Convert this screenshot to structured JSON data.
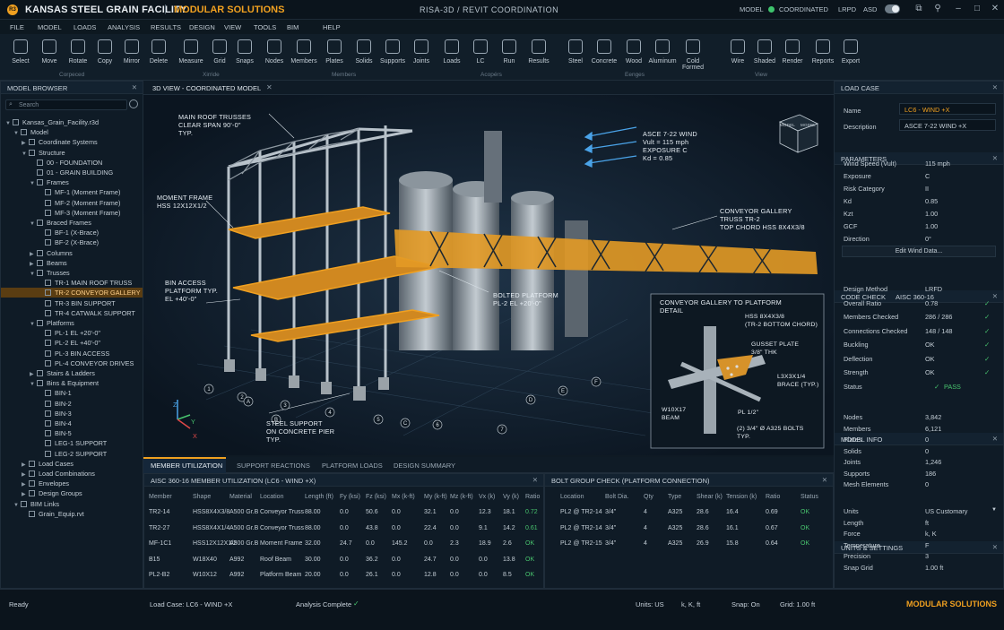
{
  "app": {
    "logo": "R3",
    "name": "KANSAS STEEL GRAIN FACILITY",
    "sep": "|",
    "subtitle": "MODULAR SOLUTIONS",
    "center_title": "RISA-3D / REVIT COORDINATION",
    "model_label": "MODEL",
    "model_status": "COORDINATED",
    "lrfd": "LRPD",
    "asd": "ASD"
  },
  "menu": [
    "FILE",
    "MODEL",
    "LOADS",
    "ANALYSIS",
    "RESULTS",
    "DESIGN",
    "VIEW",
    "TOOLS",
    "BIM",
    "HELP"
  ],
  "ribbon": {
    "tools": [
      {
        "label": "Select",
        "icon": "select-icon"
      },
      {
        "label": "Move",
        "icon": "move-icon"
      },
      {
        "label": "Rotate",
        "icon": "rotate-icon"
      },
      {
        "label": "Copy",
        "icon": "copy-icon"
      },
      {
        "label": "Mirror",
        "icon": "mirror-icon"
      },
      {
        "label": "Delete",
        "icon": "delete-icon"
      },
      {
        "label": "Measure",
        "icon": "measure-icon"
      },
      {
        "label": "Grid",
        "icon": "grid-icon"
      },
      {
        "label": "Snaps",
        "icon": "snaps-icon"
      },
      {
        "label": "Nodes",
        "icon": "nodes-icon"
      },
      {
        "label": "Members",
        "icon": "members-icon"
      },
      {
        "label": "Plates",
        "icon": "plates-icon"
      },
      {
        "label": "Solids",
        "icon": "solids-icon"
      },
      {
        "label": "Supports",
        "icon": "supports-icon"
      },
      {
        "label": "Joints",
        "icon": "joints-icon"
      },
      {
        "label": "Loads",
        "icon": "loads-icon"
      },
      {
        "label": "LC",
        "icon": "lc-icon"
      },
      {
        "label": "Run",
        "icon": "run-icon"
      },
      {
        "label": "Results",
        "icon": "results-icon"
      },
      {
        "label": "Steel",
        "icon": "steel-icon"
      },
      {
        "label": "Concrete",
        "icon": "concrete-icon"
      },
      {
        "label": "Wood",
        "icon": "wood-icon"
      },
      {
        "label": "Aluminum",
        "icon": "aluminum-icon"
      },
      {
        "label": "Cold Formed",
        "icon": "cold-formed-icon"
      },
      {
        "label": "Wire",
        "icon": "wire-icon"
      },
      {
        "label": "Shaded",
        "icon": "shaded-icon"
      },
      {
        "label": "Render",
        "icon": "render-icon"
      },
      {
        "label": "Reports",
        "icon": "reports-icon"
      },
      {
        "label": "Export",
        "icon": "export-icon"
      }
    ],
    "groups": [
      "Corpeced",
      "Xirride",
      "Members",
      "Acopérs",
      "Eenges",
      "View"
    ]
  },
  "browser": {
    "title": "MODEL BROWSER",
    "search_placeholder": "Search",
    "items": [
      "Kansas_Grain_Facility.r3d",
      "Model",
      "Coordinate Systems",
      "Structure",
      "00 - FOUNDATION",
      "01 - GRAIN BUILDING",
      "Frames",
      "MF-1 (Moment Frame)",
      "MF-2 (Moment Frame)",
      "MF-3 (Moment Frame)",
      "Braced Frames",
      "BF-1 (X-Brace)",
      "BF-2 (X-Brace)",
      "Columns",
      "Beams",
      "Trusses",
      "TR-1 MAIN ROOF TRUSS",
      "TR-2 CONVEYOR GALLERY",
      "TR-3 BIN SUPPORT",
      "TR-4 CATWALK SUPPORT",
      "Platforms",
      "PL-1 EL +20'-0\"",
      "PL-2 EL +40'-0\"",
      "PL-3 BIN ACCESS",
      "PL-4 CONVEYOR DRIVES",
      "Stairs & Ladders",
      "Bins & Equipment",
      "BIN-1",
      "BIN-2",
      "BIN-3",
      "BIN-4",
      "BIN-5",
      "LEG-1 SUPPORT",
      "LEG-2 SUPPORT",
      "Load Cases",
      "Load Combinations",
      "Envelopes",
      "Design Groups",
      "BIM Links",
      "Grain_Equip.rvt"
    ]
  },
  "view": {
    "tab": "3D VIEW - COORDINATED MODEL",
    "cube_top": "MODEL",
    "cube_side": "MODEL",
    "ann": {
      "roof": [
        "MAIN ROOF TRUSSES",
        "CLEAR SPAN 90'-0\"",
        "TYP."
      ],
      "wind": [
        "ASCE 7-22 WIND",
        "Vult = 115 mph",
        "EXPOSURE C",
        "Kd = 0.85"
      ],
      "moment": [
        "MOMENT FRAME",
        "HSS 12X12X1/2"
      ],
      "conveyor": [
        "CONVEYOR GALLERY",
        "TRUSS TR-2",
        "TOP CHORD HSS 8X4X3/8"
      ],
      "bin": [
        "BIN ACCESS",
        "PLATFORM TYP.",
        "EL +40'-0\""
      ],
      "bolted": [
        "BOLTED PLATFORM",
        "PL-2 EL +20'-0\""
      ],
      "steel": [
        "STEEL SUPPORT",
        "ON CONCRETE PIER",
        "TYP."
      ]
    },
    "detail": {
      "title": [
        "CONVEYOR GALLERY TO PLATFORM",
        "DETAIL"
      ],
      "hss": [
        "HSS 8X4X3/8",
        "(TR-2 BOTTOM CHORD)"
      ],
      "gusset": [
        "GUSSET PLATE",
        "3/8\" THK"
      ],
      "brace": [
        "L3X3X1/4",
        "BRACE (TYP.)"
      ],
      "beam": [
        "W10X17",
        "BEAM"
      ],
      "pl": "PL 1/2\"",
      "bolts": [
        "(2) 3/4\" Ø A325 BOLTS",
        "TYP."
      ]
    },
    "axes": {
      "x": "X",
      "y": "Y",
      "z": "Z"
    },
    "grid_bubbles": [
      "1",
      "2",
      "3",
      "4",
      "5",
      "6",
      "7",
      "A",
      "B",
      "C",
      "D",
      "E",
      "F"
    ]
  },
  "bottom_tabs": [
    "MEMBER UTILIZATION",
    "SUPPORT REACTIONS",
    "PLATFORM LOADS",
    "DESIGN SUMMARY"
  ],
  "util": {
    "title": "AISC 360-16 MEMBER UTILIZATION (LC6 - WIND +X)",
    "cols": [
      "Member",
      "Shape",
      "Material",
      "Location",
      "Length (ft)",
      "Fy (ksi)",
      "Fz (ksi)",
      "Mx (k-ft)",
      "My (k-ft)",
      "Mz (k-ft)",
      "Vx (k)",
      "Vy (k)",
      "Ratio"
    ],
    "rows": [
      [
        "TR2-14",
        "HSS8X4X3/8",
        "A500 Gr.B",
        "Conveyor Truss",
        "88.00",
        "0.0",
        "50.6",
        "0.0",
        "32.1",
        "0.0",
        "12.3",
        "18.1",
        "0.72"
      ],
      [
        "TR2-27",
        "HSS8X4X1/4",
        "A500 Gr.B",
        "Conveyor Truss",
        "88.00",
        "0.0",
        "43.8",
        "0.0",
        "22.4",
        "0.0",
        "9.1",
        "14.2",
        "0.61"
      ],
      [
        "MF-1C1",
        "HSS12X12X1/2",
        "A500 Gr.B",
        "Moment Frame",
        "32.00",
        "24.7",
        "0.0",
        "145.2",
        "0.0",
        "2.3",
        "18.9",
        "2.6",
        "OK"
      ],
      [
        "B15",
        "W18X40",
        "A992",
        "Roof Beam",
        "30.00",
        "0.0",
        "36.2",
        "0.0",
        "24.7",
        "0.0",
        "0.0",
        "13.8",
        "OK"
      ],
      [
        "PL2-B2",
        "W10X12",
        "A992",
        "Platform Beam",
        "20.00",
        "0.0",
        "26.1",
        "0.0",
        "12.8",
        "0.0",
        "0.0",
        "8.5",
        "OK"
      ]
    ]
  },
  "bolt": {
    "title": "BOLT GROUP CHECK (PLATFORM CONNECTION)",
    "cols": [
      "Location",
      "Bolt Dia.",
      "Qty",
      "Type",
      "Shear (k)",
      "Tension (k)",
      "Ratio",
      "Status"
    ],
    "rows": [
      [
        "PL2 @ TR2-14",
        "3/4\"",
        "4",
        "A325",
        "28.6",
        "16.4",
        "0.69",
        "OK"
      ],
      [
        "PL2 @ TR2-14",
        "3/4\"",
        "4",
        "A325",
        "28.6",
        "16.1",
        "0.67",
        "OK"
      ],
      [
        "PL2 @ TR2-15",
        "3/4\"",
        "4",
        "A325",
        "26.9",
        "15.8",
        "0.64",
        "OK"
      ]
    ]
  },
  "right": {
    "loadcase": {
      "title": "LOAD CASE",
      "name_label": "Name",
      "name": "LC6 - WIND +X",
      "desc_label": "Description",
      "desc": "ASCE 7-22 WIND +X"
    },
    "params": {
      "title": "PARAMETERS",
      "rows": [
        [
          "Wind Speed (Vult)",
          "115 mph"
        ],
        [
          "Exposure",
          "C"
        ],
        [
          "Risk Category",
          "II"
        ],
        [
          "Kd",
          "0.85"
        ],
        [
          "Kzt",
          "1.00"
        ],
        [
          "GCF",
          "1.00"
        ],
        [
          "Direction",
          "0°"
        ]
      ],
      "button": "Edit Wind Data..."
    },
    "code": {
      "title": "CODE CHECK",
      "code": "AISC 360-16",
      "rows": [
        [
          "Design Method",
          "LRFD",
          ""
        ],
        [
          "Overall Ratio",
          "0.78",
          "✓"
        ],
        [
          "Members Checked",
          "286 / 286",
          "✓"
        ],
        [
          "Connections Checked",
          "148 / 148",
          "✓"
        ],
        [
          "Buckling",
          "OK",
          "✓"
        ],
        [
          "Deflection",
          "OK",
          "✓"
        ],
        [
          "Strength",
          "OK",
          "✓"
        ]
      ],
      "status_label": "Status",
      "status": "PASS"
    },
    "info": {
      "title": "MODEL INFO",
      "rows": [
        [
          "Nodes",
          "3,842"
        ],
        [
          "Members",
          "6,121"
        ],
        [
          "Plates",
          "0"
        ],
        [
          "Solids",
          "0"
        ],
        [
          "Joints",
          "1,246"
        ],
        [
          "Supports",
          "186"
        ],
        [
          "Mesh Elements",
          "0"
        ]
      ]
    },
    "units": {
      "title": "UNITS & SETTINGS",
      "rows": [
        [
          "Units",
          "US Customary"
        ],
        [
          "Length",
          "ft"
        ],
        [
          "Force",
          "k, K"
        ],
        [
          "Temperature",
          "F"
        ],
        [
          "Precision",
          "3"
        ],
        [
          "Snap Grid",
          "1.00 ft"
        ]
      ]
    }
  },
  "status": {
    "ready": "Ready",
    "loadcase": "Load Case:  LC6 - WIND +X",
    "analysis": "Analysis Complete",
    "units": "Units:  US",
    "units2": "k, K, ft",
    "snap": "Snap:  On",
    "grid": "Grid:  1.00 ft",
    "brand": "MODULAR SOLUTIONS"
  },
  "colors": {
    "accent": "#f0a020",
    "ok": "#48c46e",
    "bg": "#0f1b26"
  }
}
